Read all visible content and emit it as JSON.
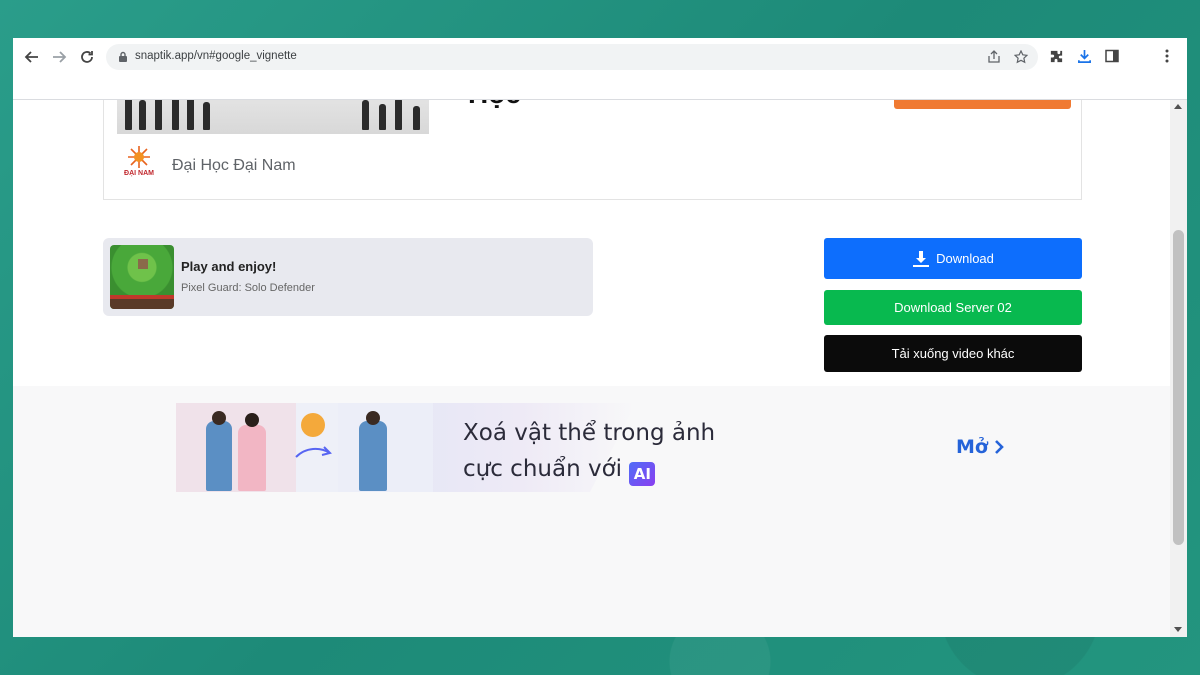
{
  "browser": {
    "url": "snaptik.app/vn#google_vignette"
  },
  "ad": {
    "title": "Học",
    "brand": "Đại Học Đại Nam",
    "logo_text": "ĐẠI NAM"
  },
  "game_card": {
    "title": "Play and enjoy!",
    "subtitle": "Pixel Guard: Solo Defender"
  },
  "buttons": {
    "download": "Download",
    "server2": "Download Server 02",
    "other": "Tải xuống video khác"
  },
  "banner": {
    "line1": "Xoá vật thể trong ảnh",
    "line2": "cực chuẩn với",
    "ai_badge": "AI",
    "open": "Mở"
  },
  "colors": {
    "download": "#0d6efd",
    "server2": "#08b94f",
    "other": "#0b0b0b",
    "ad_orange": "#f07a32",
    "link_blue": "#2563d9"
  }
}
